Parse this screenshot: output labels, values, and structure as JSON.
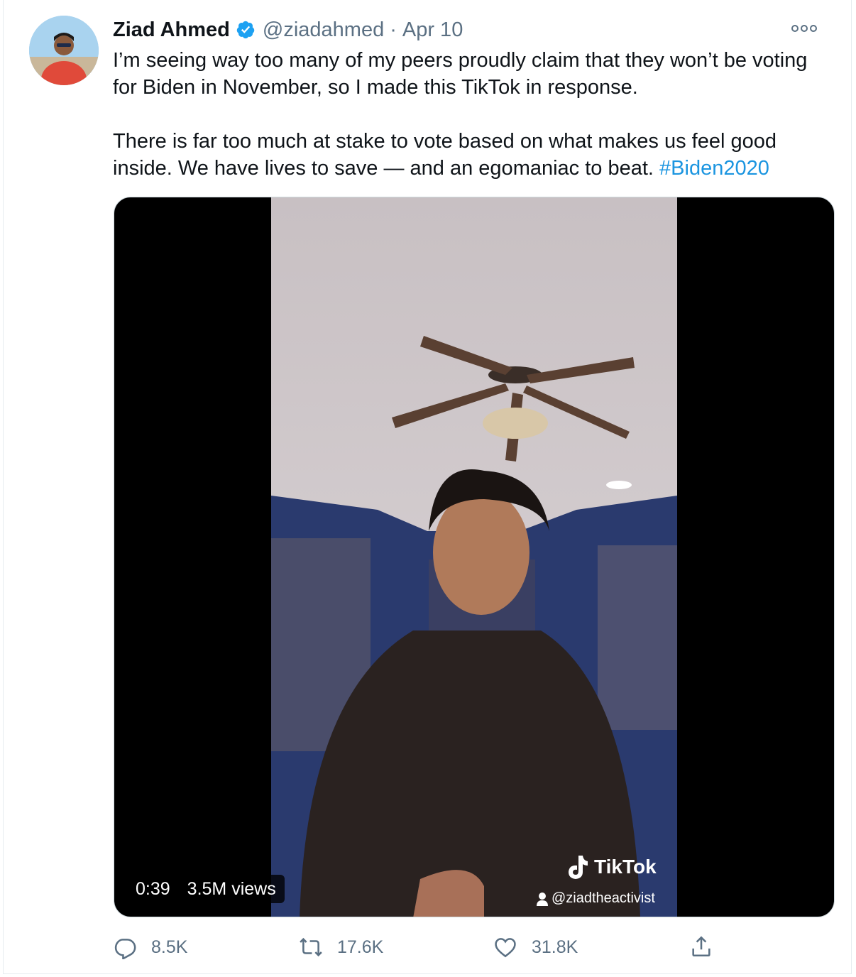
{
  "tweet": {
    "author_name": "Ziad Ahmed",
    "author_handle": "@ziadahmed",
    "separator": "·",
    "date": "Apr 10",
    "text_paragraph_1": "I’m seeing way too many of my peers proudly claim that they won’t be voting for Biden in November, so I made this TikTok in response.",
    "text_paragraph_2": "There is far too much at stake to vote based on what makes us feel good inside. We have lives to save — and an egomaniac to beat.",
    "hashtag": "#Biden2020"
  },
  "video": {
    "duration": "0:39",
    "views": "3.5M views",
    "watermark_brand": "TikTok",
    "watermark_user": "@ziadtheactivist"
  },
  "actions": {
    "replies": "8.5K",
    "retweets": "17.6K",
    "likes": "31.8K"
  },
  "colors": {
    "link": "#1b95e0",
    "secondary_text": "#5b7083",
    "verified_badge": "#1da1f2"
  },
  "icons": [
    "verified-icon",
    "more-options-icon",
    "tiktok-logo-icon",
    "user-icon",
    "reply-icon",
    "retweet-icon",
    "like-icon",
    "share-icon"
  ]
}
